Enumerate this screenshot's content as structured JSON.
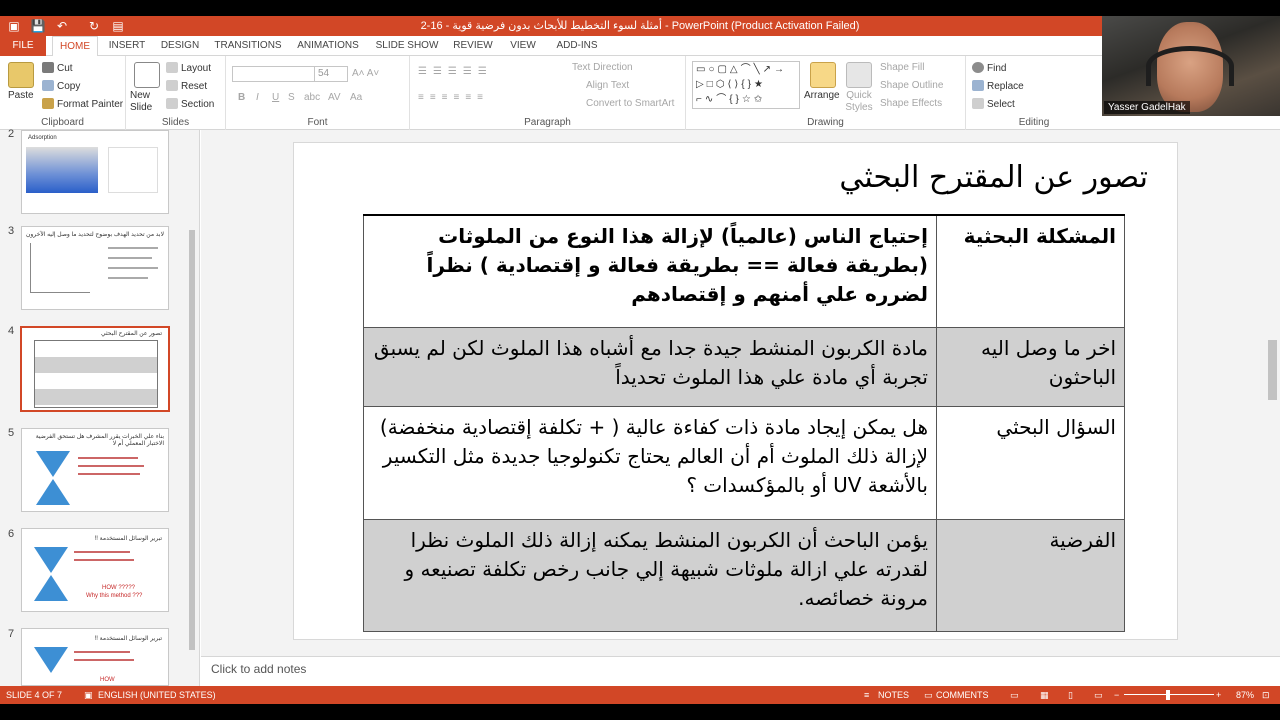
{
  "titlebar": {
    "title": "2-16 - أمثلة لسوء التخطيط للأبحاث بدون فرضية قوية - PowerPoint (Product Activation Failed)"
  },
  "ribbon_tabs": [
    "FILE",
    "HOME",
    "INSERT",
    "DESIGN",
    "TRANSITIONS",
    "ANIMATIONS",
    "SLIDE SHOW",
    "REVIEW",
    "VIEW",
    "ADD-INS"
  ],
  "clipboard": {
    "paste": "Paste",
    "cut": "Cut",
    "copy": "Copy",
    "format_painter": "Format Painter",
    "label": "Clipboard"
  },
  "slides_group": {
    "new_slide": "New Slide",
    "layout": "Layout",
    "reset": "Reset",
    "section": "Section",
    "label": "Slides"
  },
  "font_group": {
    "font_size": "54",
    "bold": "B",
    "italic": "I",
    "underline": "U",
    "strike": "S",
    "shadow": "abc",
    "spacing": "AV",
    "case": "Aa",
    "label": "Font"
  },
  "paragraph_group": {
    "text_direction": "Text Direction",
    "align_text": "Align Text",
    "smartart": "Convert to SmartArt",
    "label": "Paragraph"
  },
  "drawing_group": {
    "arrange": "Arrange",
    "quick_styles": "Quick Styles",
    "shape_fill": "Shape Fill",
    "shape_outline": "Shape Outline",
    "shape_effects": "Shape Effects",
    "label": "Drawing"
  },
  "editing_group": {
    "find": "Find",
    "replace": "Replace",
    "select": "Select",
    "label": "Editing"
  },
  "webcam": {
    "name": "Yasser GadelHak"
  },
  "thumbnails": [
    {
      "num": "2",
      "title": "Adsorption"
    },
    {
      "num": "3",
      "title": "لابد من تحديد الهدف بوضوح لتحديد ما وصل إليه الآخرون"
    },
    {
      "num": "4",
      "title": "تصور عن المقترح البحثي"
    },
    {
      "num": "5",
      "title": "بناء علي الخبرات يقرر المشرف هل تستحق الفرضية الاختبار المعملي أم لا"
    },
    {
      "num": "6",
      "title": "تبرير الوسائل المستخدمة !!",
      "extra1": "HOW ?????",
      "extra2": "Why this method ???"
    },
    {
      "num": "7",
      "title": "تبرير الوسائل المستخدمة !!",
      "extra1": "HOW"
    }
  ],
  "slide": {
    "title": "تصور عن المقترح البحثي",
    "rows": [
      {
        "header": "المشكلة البحثية",
        "content": "إحتياج الناس (عالمياً) لإزالة هذا النوع من الملوثات (بطريقة فعالة == بطريقة فعالة و إقتصادية ) نظراً لضرره علي أمنهم و إقتصادهم"
      },
      {
        "header": "اخر ما وصل اليه الباحثون",
        "content": "مادة الكربون المنشط جيدة جدا مع أشباه هذا الملوث لكن لم يسبق تجربة أي مادة علي هذا الملوث تحديداً"
      },
      {
        "header": "السؤال البحثي",
        "content": "هل يمكن إيجاد مادة ذات كفاءة عالية ( + تكلفة إقتصادية منخفضة) لإزالة ذلك الملوث أم أن العالم يحتاج تكنولوجيا جديدة مثل التكسير بالأشعة UV أو بالمؤكسدات ؟"
      },
      {
        "header": "الفرضية",
        "content": "يؤمن الباحث أن الكربون المنشط يمكنه إزالة ذلك الملوث نظرا لقدرته علي ازالة ملوثات شبيهة إلي جانب رخص تكلفة تصنيعه و مرونة خصائصه."
      }
    ]
  },
  "notes": {
    "placeholder": "Click to add notes"
  },
  "status": {
    "slide_of": "SLIDE 4 OF 7",
    "language": "ENGLISH (UNITED STATES)",
    "notes": "NOTES",
    "comments": "COMMENTS",
    "zoom": "87%"
  },
  "colors": {
    "accent": "#d24726",
    "gray_row": "#d0d0d0"
  }
}
